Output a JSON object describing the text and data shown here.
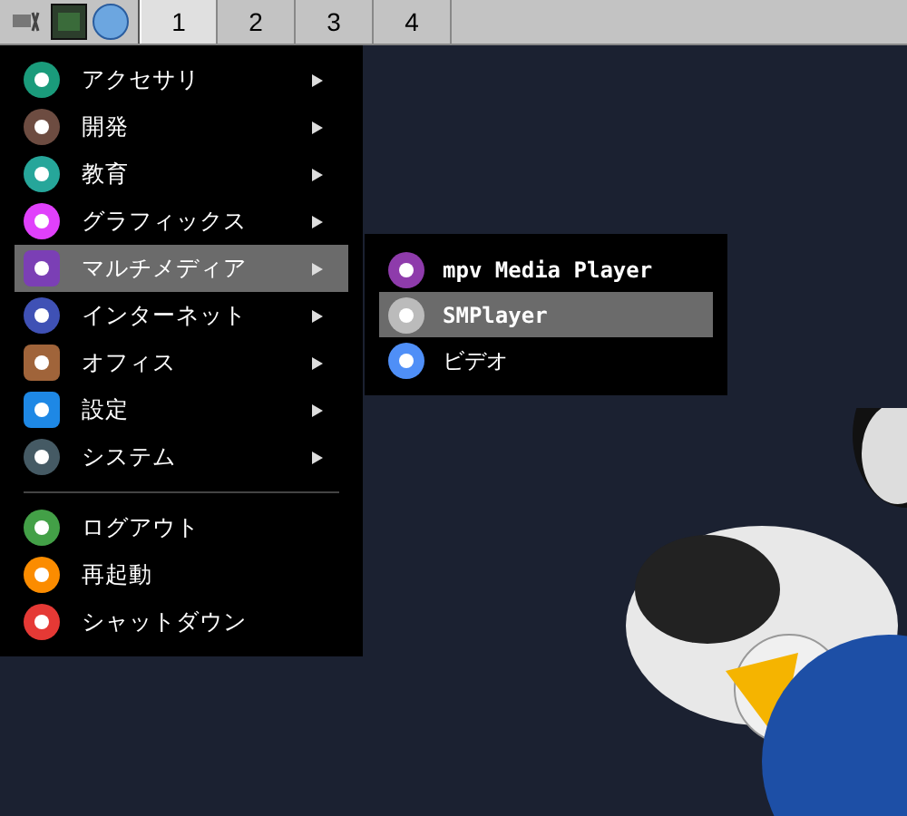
{
  "taskbar": {
    "workspaces": [
      {
        "label": "1",
        "selected": true
      },
      {
        "label": "2",
        "selected": false
      },
      {
        "label": "3",
        "selected": false
      },
      {
        "label": "4",
        "selected": false
      }
    ]
  },
  "menu": {
    "items": [
      {
        "kind": "submenu",
        "label": "アクセサリ",
        "selected": false
      },
      {
        "kind": "submenu",
        "label": "開発",
        "selected": false
      },
      {
        "kind": "submenu",
        "label": "教育",
        "selected": false
      },
      {
        "kind": "submenu",
        "label": "グラフィックス",
        "selected": false
      },
      {
        "kind": "submenu",
        "label": "マルチメディア",
        "selected": true
      },
      {
        "kind": "submenu",
        "label": "インターネット",
        "selected": false
      },
      {
        "kind": "submenu",
        "label": "オフィス",
        "selected": false
      },
      {
        "kind": "submenu",
        "label": "設定",
        "selected": false
      },
      {
        "kind": "submenu",
        "label": "システム",
        "selected": false
      },
      {
        "kind": "separator"
      },
      {
        "kind": "action",
        "label": "ログアウト",
        "selected": false
      },
      {
        "kind": "action",
        "label": "再起動",
        "selected": false
      },
      {
        "kind": "action",
        "label": "シャットダウン",
        "selected": false
      }
    ]
  },
  "submenu": {
    "items": [
      {
        "label": "mpv Media Player",
        "selected": false
      },
      {
        "label": "SMPlayer",
        "selected": true
      },
      {
        "label": "ビデオ",
        "selected": false
      }
    ]
  }
}
